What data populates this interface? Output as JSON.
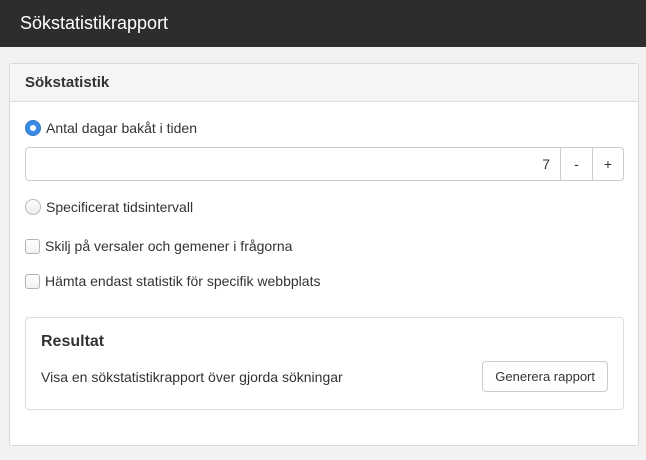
{
  "header": {
    "title": "Sökstatistikrapport"
  },
  "panel": {
    "title": "Sökstatistik",
    "radio_days": {
      "label": "Antal dagar bakåt i tiden",
      "checked": true
    },
    "stepper": {
      "value": "7",
      "minus_label": "-",
      "plus_label": "+"
    },
    "radio_interval": {
      "label": "Specificerat tidsintervall",
      "checked": false
    },
    "checkbox_case": {
      "label": "Skilj på versaler och gemener i frågorna",
      "checked": false
    },
    "checkbox_site": {
      "label": "Hämta endast statistik för specifik webbplats",
      "checked": false
    }
  },
  "result": {
    "title": "Resultat",
    "description": "Visa en sökstatistikrapport över gjorda sökningar",
    "button_label": "Generera rapport"
  },
  "colors": {
    "topbar": "#2d2d2d",
    "accent": "#3b8be6"
  }
}
